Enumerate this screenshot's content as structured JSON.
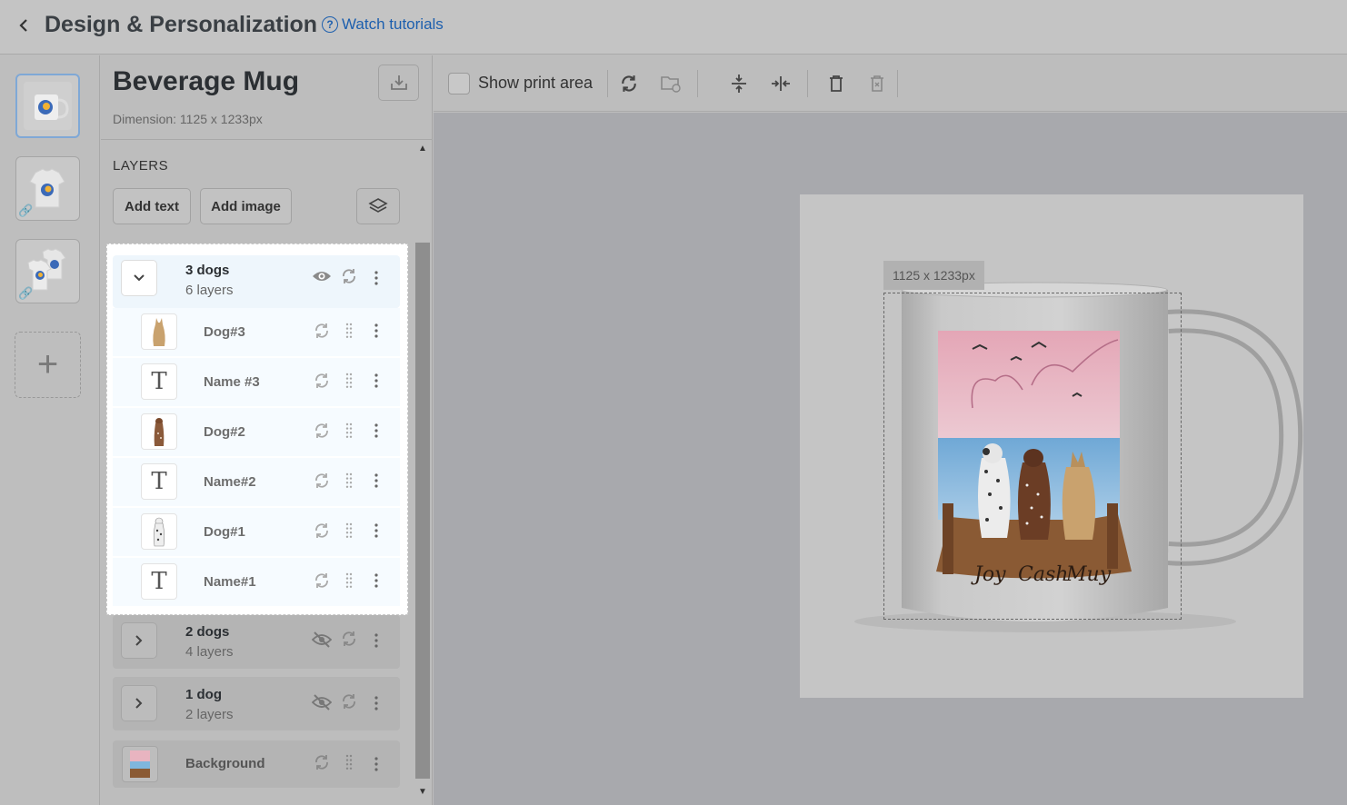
{
  "header": {
    "title": "Design & Personalization",
    "watch_label": "Watch tutorials"
  },
  "product": {
    "title": "Beverage Mug",
    "dimension": "Dimension: 1125 x 1233px"
  },
  "layers": {
    "section_title": "LAYERS",
    "add_text_label": "Add text",
    "add_image_label": "Add image",
    "groups": [
      {
        "name": "3 dogs",
        "count": "6 layers",
        "visible": true,
        "expanded": true,
        "items": [
          {
            "label": "Dog#3",
            "kind": "image"
          },
          {
            "label": "Name #3",
            "kind": "text"
          },
          {
            "label": "Dog#2",
            "kind": "image"
          },
          {
            "label": "Name#2",
            "kind": "text"
          },
          {
            "label": "Dog#1",
            "kind": "image"
          },
          {
            "label": "Name#1",
            "kind": "text"
          }
        ]
      },
      {
        "name": "2 dogs",
        "count": "4 layers",
        "visible": false,
        "expanded": false
      },
      {
        "name": "1 dog",
        "count": "2 layers",
        "visible": false,
        "expanded": false
      }
    ],
    "background_label": "Background"
  },
  "toolbar": {
    "show_print_area_label": "Show print area",
    "show_print_area_checked": false
  },
  "canvas": {
    "size_tag": "1125 x 1233px",
    "mug_names": [
      "Joy",
      "Cash",
      "Muy"
    ]
  },
  "colors": {
    "link": "#1d5fae",
    "sky_pink": "#e8b4c0",
    "water_blue": "#7fb6dd",
    "dock_brown": "#8a5a34"
  }
}
